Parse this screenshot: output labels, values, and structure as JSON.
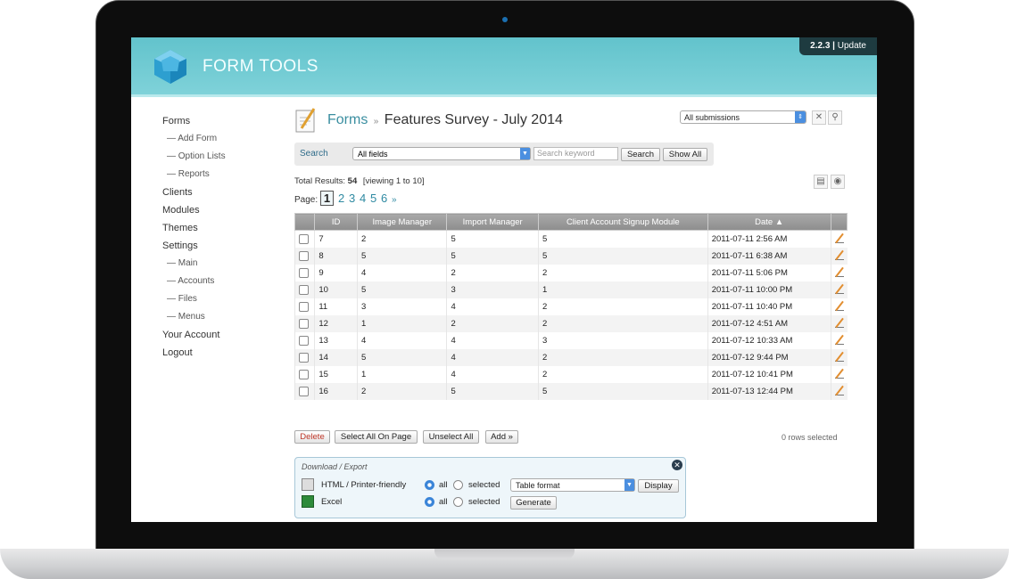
{
  "app": {
    "logo_text": "FORM TOOLS",
    "version": "2.2.3",
    "update_label": "Update"
  },
  "sidebar": {
    "items": [
      {
        "label": "Forms",
        "level": 0
      },
      {
        "label": "— Add Form",
        "level": 1
      },
      {
        "label": "— Option Lists",
        "level": 1
      },
      {
        "label": "— Reports",
        "level": 1
      },
      {
        "label": "Clients",
        "level": 0
      },
      {
        "label": "Modules",
        "level": 0
      },
      {
        "label": "Themes",
        "level": 0
      },
      {
        "label": "Settings",
        "level": 0
      },
      {
        "label": "— Main",
        "level": 1
      },
      {
        "label": "— Accounts",
        "level": 1
      },
      {
        "label": "— Files",
        "level": 1
      },
      {
        "label": "— Menus",
        "level": 1
      },
      {
        "label": "Your Account",
        "level": 0
      },
      {
        "label": "Logout",
        "level": 0
      }
    ]
  },
  "page": {
    "breadcrumb": "Forms",
    "separator": "»",
    "title": "Features Survey - July 2014",
    "view_select": "All submissions"
  },
  "search": {
    "label": "Search",
    "field": "All fields",
    "placeholder": "Search keyword",
    "search_button": "Search",
    "show_all_button": "Show All"
  },
  "results": {
    "total_label": "Total Results:",
    "total": "54",
    "viewing": "[viewing 1 to 10]",
    "page_label": "Page:",
    "current_page": "1",
    "pages": [
      "2",
      "3",
      "4",
      "5",
      "6",
      "»"
    ]
  },
  "table": {
    "columns": [
      "ID",
      "Image Manager",
      "Import Manager",
      "Client Account Signup Module",
      "Date ▲"
    ],
    "rows": [
      [
        "7",
        "2",
        "5",
        "5",
        "2011-07-11 2:56 AM"
      ],
      [
        "8",
        "5",
        "5",
        "5",
        "2011-07-11 6:38 AM"
      ],
      [
        "9",
        "4",
        "2",
        "2",
        "2011-07-11 5:06 PM"
      ],
      [
        "10",
        "5",
        "3",
        "1",
        "2011-07-11 10:00 PM"
      ],
      [
        "11",
        "3",
        "4",
        "2",
        "2011-07-11 10:40 PM"
      ],
      [
        "12",
        "1",
        "2",
        "2",
        "2011-07-12 4:51 AM"
      ],
      [
        "13",
        "4",
        "4",
        "3",
        "2011-07-12 10:33 AM"
      ],
      [
        "14",
        "5",
        "4",
        "2",
        "2011-07-12 9:44 PM"
      ],
      [
        "15",
        "1",
        "4",
        "2",
        "2011-07-12 10:41 PM"
      ],
      [
        "16",
        "2",
        "5",
        "5",
        "2011-07-13 12:44 PM"
      ]
    ]
  },
  "actions": {
    "delete": "Delete",
    "select_all": "Select All On Page",
    "unselect_all": "Unselect All",
    "add": "Add »",
    "rows_selected": "0 rows selected"
  },
  "export": {
    "title": "Download / Export",
    "html_label": "HTML / Printer-friendly",
    "excel_label": "Excel",
    "all_label": "all",
    "selected_label": "selected",
    "format": "Table format",
    "display_button": "Display",
    "generate_button": "Generate"
  },
  "colors": {
    "header": "#6ccad2",
    "accent": "#3a8ea0",
    "radio": "#3b85d8"
  }
}
